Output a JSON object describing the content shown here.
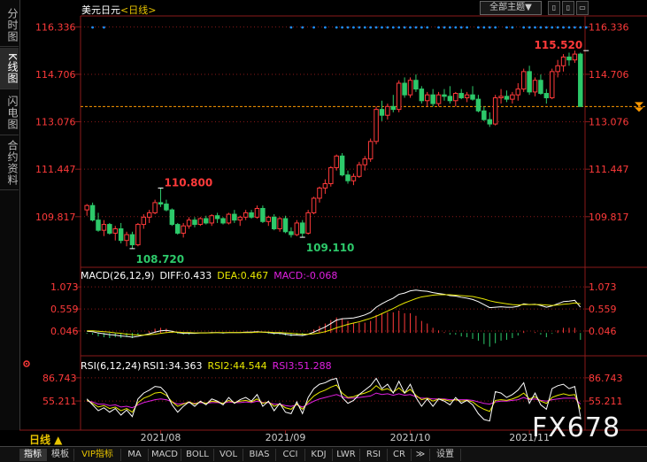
{
  "sidebar": {
    "tabs": [
      {
        "label": "分时图",
        "active": false
      },
      {
        "label": "K线图",
        "active": true
      },
      {
        "label": "闪电图",
        "active": false
      },
      {
        "label": "合约资料",
        "active": false
      }
    ]
  },
  "header": {
    "title": "美元日元",
    "period": "<日线>",
    "theme_button": "全部主题▼",
    "buttons": [
      "▯",
      "▯",
      "▭"
    ]
  },
  "watermark": "FX678",
  "period_label": "日线 ▲",
  "bottom_tabs": [
    "指标",
    "模板",
    "VIP指标",
    "MA",
    "MACD",
    "BOLL",
    "VOL",
    "BIAS",
    "CCI",
    "KDJ",
    "LWR",
    "RSI",
    "CR",
    "≫",
    "设置"
  ],
  "colors": {
    "up": "#ff3a3a",
    "down": "#2dc96a",
    "grid": "#8a1a1a",
    "diff": "#ffffff",
    "dea": "#e8e800",
    "macd": "#e020e0",
    "rsi1": "#ffffff",
    "rsi2": "#e8e800",
    "rsi3": "#e020e0",
    "price_line": "#ff9900",
    "dots": "#1e90ff",
    "axis_label": "#ff3a3a"
  },
  "chart_data": [
    {
      "type": "candlestick",
      "title": "美元日元 <日线>",
      "y_ticks": [
        "116.336",
        "114.706",
        "113.076",
        "111.447",
        "109.817"
      ],
      "ylim": [
        108.2,
        116.65
      ],
      "x_ticks": [
        {
          "label": "2021/08",
          "index": 13
        },
        {
          "label": "2021/09",
          "index": 35
        },
        {
          "label": "2021/10",
          "index": 57
        },
        {
          "label": "2021/11",
          "index": 78
        }
      ],
      "annotations": [
        {
          "label": "110.800",
          "index": 13,
          "value": 110.8,
          "color": "#ff3a3a"
        },
        {
          "label": "108.720",
          "index": 8,
          "value": 108.72,
          "color": "#2dc96a"
        },
        {
          "label": "109.110",
          "index": 38,
          "value": 109.11,
          "color": "#2dc96a"
        },
        {
          "label": "115.520",
          "index": 88,
          "value": 115.52,
          "color": "#ff3a3a"
        }
      ],
      "reference_line": 113.6,
      "dots_row": [
        1,
        3,
        36,
        38,
        40,
        42,
        44,
        45,
        46,
        47,
        48,
        49,
        50,
        51,
        52,
        53,
        54,
        55,
        56,
        57,
        58,
        59,
        60,
        62,
        63,
        64,
        65,
        66,
        67,
        69,
        70,
        71,
        72,
        74,
        75,
        77,
        78,
        79,
        80,
        81,
        82,
        83,
        84,
        85,
        86,
        87,
        88
      ],
      "ohlc": [
        [
          110.05,
          110.25,
          109.85,
          110.2
        ],
        [
          110.2,
          110.3,
          109.65,
          109.7
        ],
        [
          109.7,
          109.95,
          109.3,
          109.35
        ],
        [
          109.35,
          109.7,
          109.15,
          109.55
        ],
        [
          109.55,
          109.6,
          109.2,
          109.25
        ],
        [
          109.25,
          109.5,
          109.0,
          109.4
        ],
        [
          109.4,
          109.6,
          108.9,
          109.0
        ],
        [
          109.0,
          109.3,
          108.8,
          109.2
        ],
        [
          109.2,
          109.3,
          108.72,
          108.85
        ],
        [
          108.85,
          109.6,
          108.8,
          109.55
        ],
        [
          109.55,
          109.9,
          109.4,
          109.8
        ],
        [
          109.8,
          110.05,
          109.6,
          109.95
        ],
        [
          109.95,
          110.4,
          109.9,
          110.3
        ],
        [
          110.3,
          110.8,
          110.15,
          110.25
        ],
        [
          110.25,
          110.4,
          110.0,
          110.05
        ],
        [
          110.05,
          110.1,
          109.5,
          109.55
        ],
        [
          109.55,
          109.6,
          109.2,
          109.25
        ],
        [
          109.25,
          109.6,
          109.1,
          109.5
        ],
        [
          109.5,
          109.8,
          109.4,
          109.7
        ],
        [
          109.7,
          109.8,
          109.45,
          109.55
        ],
        [
          109.55,
          109.8,
          109.5,
          109.75
        ],
        [
          109.75,
          109.85,
          109.55,
          109.6
        ],
        [
          109.6,
          109.9,
          109.5,
          109.85
        ],
        [
          109.85,
          109.95,
          109.6,
          109.75
        ],
        [
          109.75,
          109.8,
          109.55,
          109.6
        ],
        [
          109.6,
          109.95,
          109.55,
          109.9
        ],
        [
          109.9,
          110.05,
          109.6,
          109.7
        ],
        [
          109.7,
          109.85,
          109.5,
          109.8
        ],
        [
          109.8,
          110.05,
          109.7,
          109.95
        ],
        [
          109.95,
          110.05,
          109.75,
          109.8
        ],
        [
          109.8,
          110.2,
          109.75,
          110.1
        ],
        [
          110.1,
          110.2,
          109.6,
          109.65
        ],
        [
          109.65,
          109.85,
          109.5,
          109.8
        ],
        [
          109.8,
          109.9,
          109.35,
          109.4
        ],
        [
          109.4,
          109.8,
          109.3,
          109.75
        ],
        [
          109.75,
          109.85,
          109.25,
          109.3
        ],
        [
          109.3,
          109.45,
          109.1,
          109.2
        ],
        [
          109.2,
          109.7,
          109.15,
          109.6
        ],
        [
          109.6,
          109.7,
          109.11,
          109.25
        ],
        [
          109.25,
          110.05,
          109.2,
          109.95
        ],
        [
          109.95,
          110.5,
          109.9,
          110.45
        ],
        [
          110.45,
          110.85,
          110.3,
          110.8
        ],
        [
          110.8,
          111.1,
          110.6,
          110.95
        ],
        [
          110.95,
          111.55,
          110.85,
          111.5
        ],
        [
          111.5,
          111.95,
          111.4,
          111.9
        ],
        [
          111.9,
          112.0,
          111.2,
          111.25
        ],
        [
          111.25,
          111.4,
          110.95,
          111.05
        ],
        [
          111.05,
          111.3,
          110.9,
          111.2
        ],
        [
          111.2,
          111.7,
          111.15,
          111.6
        ],
        [
          111.6,
          111.9,
          111.4,
          111.8
        ],
        [
          111.8,
          112.5,
          111.7,
          112.4
        ],
        [
          112.4,
          113.6,
          112.3,
          113.5
        ],
        [
          113.5,
          113.8,
          113.1,
          113.3
        ],
        [
          113.3,
          113.7,
          113.15,
          113.6
        ],
        [
          113.6,
          114.0,
          113.4,
          113.5
        ],
        [
          113.5,
          114.5,
          113.4,
          114.4
        ],
        [
          114.4,
          114.6,
          113.9,
          114.0
        ],
        [
          114.0,
          114.6,
          113.9,
          114.5
        ],
        [
          114.5,
          114.7,
          114.1,
          114.2
        ],
        [
          114.2,
          114.3,
          113.7,
          113.8
        ],
        [
          113.8,
          114.1,
          113.6,
          114.0
        ],
        [
          114.0,
          114.2,
          113.6,
          113.7
        ],
        [
          113.7,
          114.1,
          113.6,
          114.0
        ],
        [
          114.0,
          114.2,
          113.8,
          113.95
        ],
        [
          113.95,
          114.3,
          113.7,
          113.8
        ],
        [
          113.8,
          114.1,
          113.6,
          114.05
        ],
        [
          114.05,
          114.2,
          113.85,
          113.9
        ],
        [
          113.9,
          114.1,
          113.75,
          114.0
        ],
        [
          114.0,
          114.3,
          113.8,
          113.85
        ],
        [
          113.85,
          114.0,
          113.4,
          113.45
        ],
        [
          113.45,
          113.6,
          113.1,
          113.15
        ],
        [
          113.15,
          113.4,
          112.9,
          113.0
        ],
        [
          113.0,
          114.0,
          112.95,
          113.9
        ],
        [
          113.9,
          114.2,
          113.7,
          113.95
        ],
        [
          113.95,
          114.15,
          113.75,
          113.85
        ],
        [
          113.85,
          114.1,
          113.7,
          114.0
        ],
        [
          114.0,
          114.4,
          113.8,
          114.2
        ],
        [
          114.2,
          114.9,
          114.1,
          114.8
        ],
        [
          114.8,
          115.0,
          114.0,
          114.1
        ],
        [
          114.1,
          114.6,
          113.95,
          114.5
        ],
        [
          114.5,
          114.7,
          114.0,
          114.05
        ],
        [
          114.05,
          114.2,
          113.7,
          113.9
        ],
        [
          113.9,
          114.9,
          113.85,
          114.8
        ],
        [
          114.8,
          115.2,
          114.6,
          115.0
        ],
        [
          115.0,
          115.4,
          114.8,
          115.3
        ],
        [
          115.3,
          115.45,
          115.0,
          115.2
        ],
        [
          115.2,
          115.52,
          115.1,
          115.4
        ],
        [
          115.4,
          115.45,
          113.6,
          113.6
        ]
      ]
    },
    {
      "type": "macd",
      "name": "MACD(26,12,9)",
      "diff_label": "DIFF:0.433",
      "dea_label": "DEA:0.467",
      "macd_label": "MACD:-0.068",
      "y_ticks": [
        "1.073",
        "0.559",
        "0.046"
      ],
      "ylim": [
        -0.45,
        1.2
      ],
      "diff": [
        0.04,
        0.03,
        0.0,
        -0.02,
        -0.04,
        -0.05,
        -0.07,
        -0.08,
        -0.1,
        -0.08,
        -0.05,
        -0.02,
        0.02,
        0.05,
        0.06,
        0.04,
        0.01,
        -0.01,
        -0.01,
        -0.01,
        0.0,
        0.0,
        0.01,
        0.01,
        0.0,
        0.01,
        0.01,
        0.01,
        0.02,
        0.02,
        0.03,
        0.02,
        0.01,
        -0.01,
        -0.01,
        -0.03,
        -0.05,
        -0.05,
        -0.06,
        -0.03,
        0.02,
        0.08,
        0.14,
        0.22,
        0.3,
        0.33,
        0.34,
        0.35,
        0.38,
        0.42,
        0.48,
        0.6,
        0.68,
        0.75,
        0.81,
        0.9,
        0.93,
        0.98,
        1.0,
        0.98,
        0.97,
        0.94,
        0.92,
        0.9,
        0.87,
        0.86,
        0.83,
        0.81,
        0.78,
        0.73,
        0.66,
        0.59,
        0.6,
        0.61,
        0.6,
        0.6,
        0.62,
        0.68,
        0.66,
        0.67,
        0.64,
        0.6,
        0.63,
        0.68,
        0.73,
        0.74,
        0.76,
        0.6
      ],
      "dea": [
        0.05,
        0.05,
        0.04,
        0.03,
        0.02,
        0.0,
        -0.01,
        -0.03,
        -0.04,
        -0.05,
        -0.05,
        -0.04,
        -0.03,
        -0.01,
        0.01,
        0.02,
        0.02,
        0.01,
        0.01,
        0.0,
        0.0,
        0.0,
        0.0,
        0.01,
        0.01,
        0.01,
        0.01,
        0.01,
        0.01,
        0.01,
        0.02,
        0.02,
        0.02,
        0.01,
        0.01,
        0.0,
        -0.01,
        -0.02,
        -0.03,
        -0.03,
        -0.02,
        0.0,
        0.03,
        0.07,
        0.12,
        0.16,
        0.2,
        0.23,
        0.26,
        0.3,
        0.34,
        0.39,
        0.45,
        0.51,
        0.57,
        0.64,
        0.7,
        0.75,
        0.8,
        0.84,
        0.86,
        0.88,
        0.89,
        0.89,
        0.89,
        0.88,
        0.87,
        0.86,
        0.85,
        0.82,
        0.79,
        0.75,
        0.72,
        0.7,
        0.68,
        0.66,
        0.65,
        0.66,
        0.66,
        0.66,
        0.66,
        0.65,
        0.64,
        0.65,
        0.67,
        0.68,
        0.7,
        0.68
      ]
    },
    {
      "type": "rsi",
      "name": "RSI(6,12,24)",
      "rsi1_label": "RSI1:34.363",
      "rsi2_label": "RSI2:44.544",
      "rsi3_label": "RSI3:51.288",
      "y_ticks": [
        "86.743",
        "55.211"
      ],
      "ylim": [
        18,
        95
      ],
      "rsi1": [
        58,
        50,
        42,
        46,
        40,
        45,
        36,
        43,
        34,
        58,
        66,
        70,
        75,
        74,
        66,
        50,
        40,
        48,
        54,
        48,
        55,
        50,
        58,
        55,
        50,
        60,
        52,
        57,
        60,
        55,
        64,
        48,
        55,
        42,
        52,
        40,
        38,
        54,
        38,
        60,
        72,
        78,
        80,
        84,
        86,
        60,
        52,
        56,
        64,
        70,
        76,
        86,
        72,
        78,
        66,
        82,
        66,
        78,
        60,
        48,
        58,
        48,
        58,
        55,
        50,
        60,
        52,
        56,
        50,
        38,
        30,
        28,
        68,
        66,
        60,
        64,
        70,
        80,
        52,
        66,
        50,
        44,
        72,
        76,
        78,
        72,
        75,
        34
      ],
      "rsi2": [
        56,
        52,
        47,
        49,
        45,
        47,
        42,
        45,
        40,
        53,
        59,
        62,
        66,
        67,
        63,
        54,
        48,
        51,
        54,
        51,
        54,
        52,
        55,
        54,
        52,
        56,
        53,
        55,
        56,
        54,
        58,
        52,
        54,
        48,
        51,
        46,
        44,
        51,
        44,
        54,
        62,
        67,
        70,
        74,
        77,
        66,
        60,
        61,
        64,
        66,
        69,
        76,
        70,
        72,
        67,
        73,
        66,
        71,
        63,
        57,
        59,
        55,
        58,
        57,
        55,
        57,
        55,
        56,
        54,
        48,
        44,
        41,
        56,
        57,
        56,
        58,
        61,
        66,
        58,
        61,
        55,
        52,
        60,
        63,
        65,
        63,
        64,
        44
      ],
      "rsi3": [
        55,
        54,
        51,
        51,
        49,
        50,
        47,
        48,
        46,
        50,
        53,
        55,
        57,
        58,
        57,
        54,
        51,
        52,
        53,
        52,
        53,
        52,
        53,
        53,
        52,
        54,
        53,
        53,
        54,
        53,
        55,
        53,
        53,
        51,
        51,
        49,
        48,
        50,
        47,
        51,
        55,
        58,
        60,
        62,
        64,
        61,
        59,
        59,
        60,
        61,
        62,
        66,
        64,
        65,
        63,
        65,
        63,
        64,
        61,
        59,
        59,
        58,
        58,
        58,
        57,
        57,
        57,
        57,
        56,
        54,
        52,
        51,
        54,
        55,
        55,
        56,
        57,
        60,
        57,
        58,
        56,
        55,
        57,
        58,
        59,
        59,
        59,
        51
      ]
    }
  ]
}
